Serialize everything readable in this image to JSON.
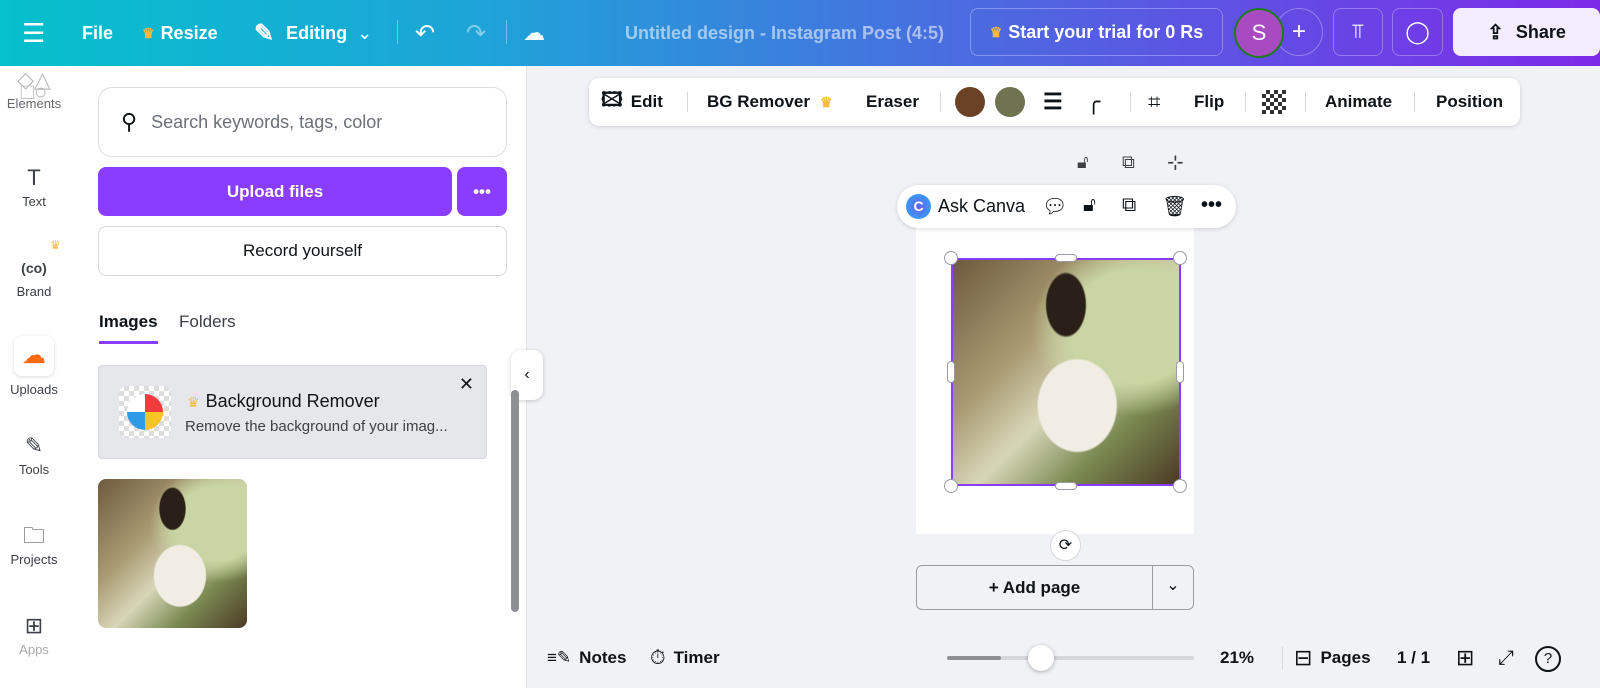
{
  "topbar": {
    "file": "File",
    "resize": "Resize",
    "editing": "Editing",
    "title": "Untitled design - Instagram Post (4:5)",
    "trial": "Start your trial for 0 Rs",
    "avatar": "S",
    "share": "Share"
  },
  "rail": [
    {
      "label": "Elements"
    },
    {
      "label": "Text"
    },
    {
      "label": "Brand"
    },
    {
      "label": "Uploads"
    },
    {
      "label": "Tools"
    },
    {
      "label": "Projects"
    },
    {
      "label": "Apps"
    }
  ],
  "panel": {
    "search_placeholder": "Search keywords, tags, color",
    "upload": "Upload files",
    "more": "•••",
    "record": "Record yourself",
    "tabs": [
      "Images",
      "Folders"
    ],
    "promo_title": "Background Remover",
    "promo_desc": "Remove the background of your imag..."
  },
  "context_toolbar": {
    "edit": "Edit",
    "bg_remover": "BG Remover",
    "eraser": "Eraser",
    "flip": "Flip",
    "animate": "Animate",
    "position": "Position",
    "colors": [
      "#6b4226",
      "#6f7350"
    ]
  },
  "ask_canva": {
    "label": "Ask Canva"
  },
  "canvas": {
    "add_page": "+ Add page"
  },
  "footer": {
    "notes": "Notes",
    "timer": "Timer",
    "zoom": "21%",
    "zoom_value": 21,
    "pages": "Pages",
    "page_count": "1 / 1"
  },
  "colors": {
    "accent": "#8b3dff",
    "upload_orange": "#ff6a13"
  }
}
